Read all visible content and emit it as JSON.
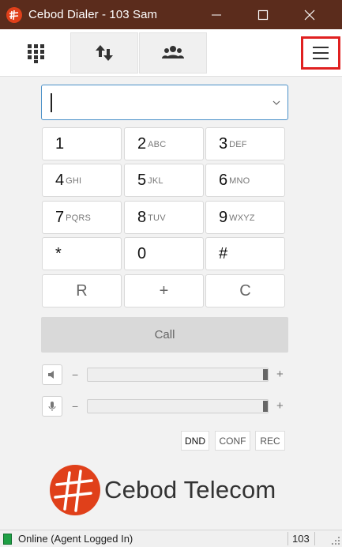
{
  "window": {
    "title": "Cebod Dialer - 103 Sam",
    "controls": [
      "minimize-icon",
      "maximize-icon",
      "close-icon"
    ]
  },
  "tabs": [
    {
      "icon": "keypad-icon",
      "active": true
    },
    {
      "icon": "transfer-arrows-icon",
      "active": false
    },
    {
      "icon": "contacts-icon",
      "active": false
    }
  ],
  "menu_icon": "hamburger-menu-icon",
  "number_input": {
    "value": "",
    "dropdown_icon": "chevron-down-icon"
  },
  "keypad": {
    "keys": [
      {
        "digit": "1",
        "letters": ""
      },
      {
        "digit": "2",
        "letters": "ABC"
      },
      {
        "digit": "3",
        "letters": "DEF"
      },
      {
        "digit": "4",
        "letters": "GHI"
      },
      {
        "digit": "5",
        "letters": "JKL"
      },
      {
        "digit": "6",
        "letters": "MNO"
      },
      {
        "digit": "7",
        "letters": "PQRS"
      },
      {
        "digit": "8",
        "letters": "TUV"
      },
      {
        "digit": "9",
        "letters": "WXYZ"
      },
      {
        "digit": "*",
        "letters": ""
      },
      {
        "digit": "0",
        "letters": ""
      },
      {
        "digit": "#",
        "letters": ""
      }
    ],
    "actions": {
      "redial": "R",
      "plus": "+",
      "clear": "C"
    }
  },
  "call_label": "Call",
  "speaker": {
    "icon": "speaker-icon",
    "minus": "−",
    "plus": "+",
    "level": 1.0
  },
  "microphone": {
    "icon": "microphone-icon",
    "minus": "−",
    "plus": "+",
    "level": 1.0
  },
  "buttons": {
    "dnd": "DND",
    "conf": "CONF",
    "rec": "REC"
  },
  "brand": {
    "name": "Cebod Telecom",
    "logo": "cebod-logo",
    "color": "#e0401a"
  },
  "status": {
    "text": "Online (Agent Logged In)",
    "extension": "103",
    "indicator_color": "#1fa045"
  },
  "colors": {
    "titlebar": "#5b2c1c",
    "highlight": "#e02020",
    "input_border": "#4a90c8"
  }
}
